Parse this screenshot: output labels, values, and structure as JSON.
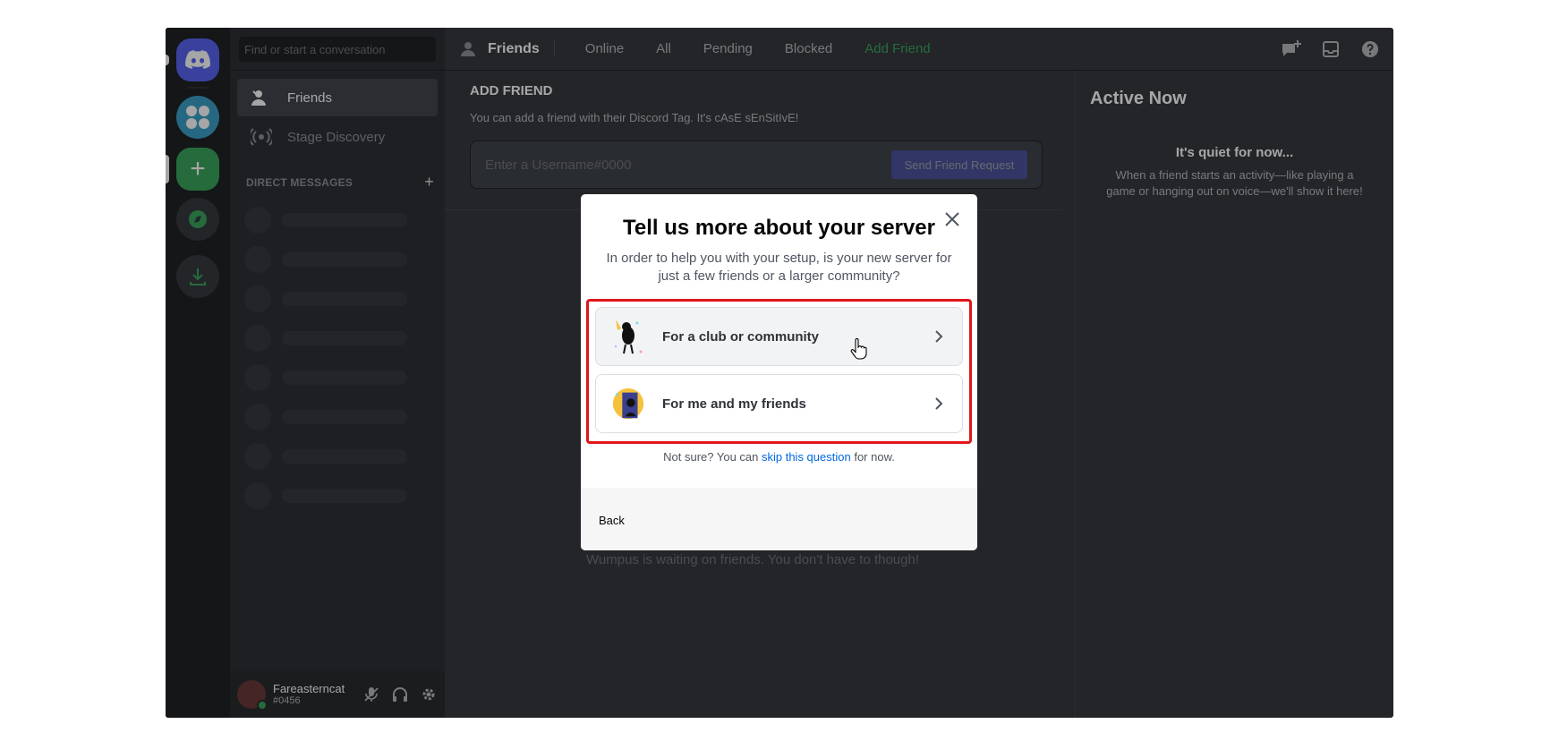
{
  "sidebar": {
    "search_placeholder": "Find or start a conversation",
    "nav": [
      {
        "label": "Friends",
        "icon": "friends-icon"
      },
      {
        "label": "Stage Discovery",
        "icon": "stage-icon"
      }
    ],
    "dm_header": "DIRECT MESSAGES",
    "dm_add": "+"
  },
  "user": {
    "name": "Fareasterncat",
    "tag": "#0456"
  },
  "topbar": {
    "title": "Friends",
    "tabs": [
      "Online",
      "All",
      "Pending",
      "Blocked"
    ],
    "add_friend_tab": "Add Friend"
  },
  "add_friend": {
    "title": "ADD FRIEND",
    "desc": "You can add a friend with their Discord Tag. It's cAsE sEnSitIvE!",
    "placeholder": "Enter a Username#0000",
    "button": "Send Friend Request"
  },
  "empty_state": "Wumpus is waiting on friends. You don't have to though!",
  "active_now": {
    "title": "Active Now",
    "quiet": "It's quiet for now...",
    "desc": "When a friend starts an activity—like playing a game or hanging out on voice—we'll show it here!"
  },
  "modal": {
    "title": "Tell us more about your server",
    "subtitle": "In order to help you with your setup, is your new server for just a few friends or a larger community?",
    "options": [
      {
        "label": "For a club or community"
      },
      {
        "label": "For me and my friends"
      }
    ],
    "note_prefix": "Not sure? You can ",
    "note_link": "skip this question",
    "note_suffix": " for now.",
    "back": "Back"
  },
  "colors": {
    "highlight": "#e0161b",
    "blurple": "#5865f2",
    "green": "#3ba55d"
  }
}
